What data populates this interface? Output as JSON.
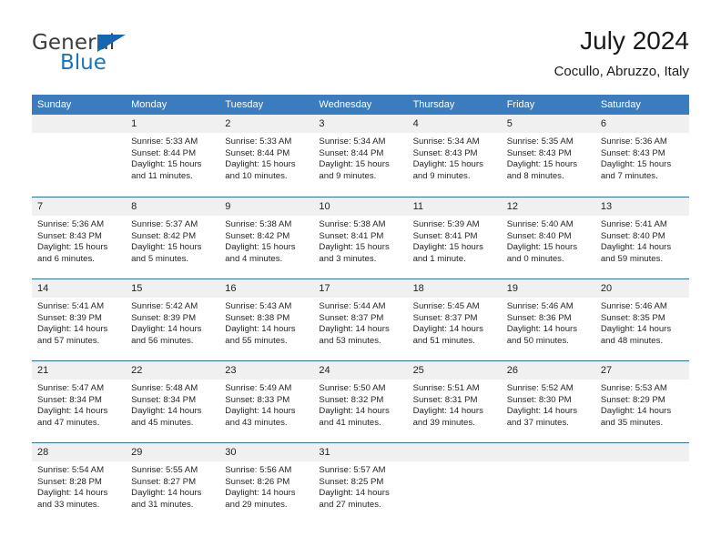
{
  "brand": {
    "name_top": "General",
    "name_bottom": "Blue",
    "accent_color": "#1b75bb",
    "triangle_color": "#1567b2"
  },
  "header": {
    "title": "July 2024",
    "subtitle": "Cocullo, Abruzzo, Italy"
  },
  "calendar": {
    "header_bg": "#3a7cbe",
    "header_text_color": "#ffffff",
    "daynum_band_bg": "#f0f0f0",
    "row_divider_color": "#2f6ea8",
    "weekdays": [
      "Sunday",
      "Monday",
      "Tuesday",
      "Wednesday",
      "Thursday",
      "Friday",
      "Saturday"
    ],
    "weeks": [
      [
        {
          "day": "",
          "lines": []
        },
        {
          "day": "1",
          "lines": [
            "Sunrise: 5:33 AM",
            "Sunset: 8:44 PM",
            "Daylight: 15 hours",
            "and 11 minutes."
          ]
        },
        {
          "day": "2",
          "lines": [
            "Sunrise: 5:33 AM",
            "Sunset: 8:44 PM",
            "Daylight: 15 hours",
            "and 10 minutes."
          ]
        },
        {
          "day": "3",
          "lines": [
            "Sunrise: 5:34 AM",
            "Sunset: 8:44 PM",
            "Daylight: 15 hours",
            "and 9 minutes."
          ]
        },
        {
          "day": "4",
          "lines": [
            "Sunrise: 5:34 AM",
            "Sunset: 8:43 PM",
            "Daylight: 15 hours",
            "and 9 minutes."
          ]
        },
        {
          "day": "5",
          "lines": [
            "Sunrise: 5:35 AM",
            "Sunset: 8:43 PM",
            "Daylight: 15 hours",
            "and 8 minutes."
          ]
        },
        {
          "day": "6",
          "lines": [
            "Sunrise: 5:36 AM",
            "Sunset: 8:43 PM",
            "Daylight: 15 hours",
            "and 7 minutes."
          ]
        }
      ],
      [
        {
          "day": "7",
          "lines": [
            "Sunrise: 5:36 AM",
            "Sunset: 8:43 PM",
            "Daylight: 15 hours",
            "and 6 minutes."
          ]
        },
        {
          "day": "8",
          "lines": [
            "Sunrise: 5:37 AM",
            "Sunset: 8:42 PM",
            "Daylight: 15 hours",
            "and 5 minutes."
          ]
        },
        {
          "day": "9",
          "lines": [
            "Sunrise: 5:38 AM",
            "Sunset: 8:42 PM",
            "Daylight: 15 hours",
            "and 4 minutes."
          ]
        },
        {
          "day": "10",
          "lines": [
            "Sunrise: 5:38 AM",
            "Sunset: 8:41 PM",
            "Daylight: 15 hours",
            "and 3 minutes."
          ]
        },
        {
          "day": "11",
          "lines": [
            "Sunrise: 5:39 AM",
            "Sunset: 8:41 PM",
            "Daylight: 15 hours",
            "and 1 minute."
          ]
        },
        {
          "day": "12",
          "lines": [
            "Sunrise: 5:40 AM",
            "Sunset: 8:40 PM",
            "Daylight: 15 hours",
            "and 0 minutes."
          ]
        },
        {
          "day": "13",
          "lines": [
            "Sunrise: 5:41 AM",
            "Sunset: 8:40 PM",
            "Daylight: 14 hours",
            "and 59 minutes."
          ]
        }
      ],
      [
        {
          "day": "14",
          "lines": [
            "Sunrise: 5:41 AM",
            "Sunset: 8:39 PM",
            "Daylight: 14 hours",
            "and 57 minutes."
          ]
        },
        {
          "day": "15",
          "lines": [
            "Sunrise: 5:42 AM",
            "Sunset: 8:39 PM",
            "Daylight: 14 hours",
            "and 56 minutes."
          ]
        },
        {
          "day": "16",
          "lines": [
            "Sunrise: 5:43 AM",
            "Sunset: 8:38 PM",
            "Daylight: 14 hours",
            "and 55 minutes."
          ]
        },
        {
          "day": "17",
          "lines": [
            "Sunrise: 5:44 AM",
            "Sunset: 8:37 PM",
            "Daylight: 14 hours",
            "and 53 minutes."
          ]
        },
        {
          "day": "18",
          "lines": [
            "Sunrise: 5:45 AM",
            "Sunset: 8:37 PM",
            "Daylight: 14 hours",
            "and 51 minutes."
          ]
        },
        {
          "day": "19",
          "lines": [
            "Sunrise: 5:46 AM",
            "Sunset: 8:36 PM",
            "Daylight: 14 hours",
            "and 50 minutes."
          ]
        },
        {
          "day": "20",
          "lines": [
            "Sunrise: 5:46 AM",
            "Sunset: 8:35 PM",
            "Daylight: 14 hours",
            "and 48 minutes."
          ]
        }
      ],
      [
        {
          "day": "21",
          "lines": [
            "Sunrise: 5:47 AM",
            "Sunset: 8:34 PM",
            "Daylight: 14 hours",
            "and 47 minutes."
          ]
        },
        {
          "day": "22",
          "lines": [
            "Sunrise: 5:48 AM",
            "Sunset: 8:34 PM",
            "Daylight: 14 hours",
            "and 45 minutes."
          ]
        },
        {
          "day": "23",
          "lines": [
            "Sunrise: 5:49 AM",
            "Sunset: 8:33 PM",
            "Daylight: 14 hours",
            "and 43 minutes."
          ]
        },
        {
          "day": "24",
          "lines": [
            "Sunrise: 5:50 AM",
            "Sunset: 8:32 PM",
            "Daylight: 14 hours",
            "and 41 minutes."
          ]
        },
        {
          "day": "25",
          "lines": [
            "Sunrise: 5:51 AM",
            "Sunset: 8:31 PM",
            "Daylight: 14 hours",
            "and 39 minutes."
          ]
        },
        {
          "day": "26",
          "lines": [
            "Sunrise: 5:52 AM",
            "Sunset: 8:30 PM",
            "Daylight: 14 hours",
            "and 37 minutes."
          ]
        },
        {
          "day": "27",
          "lines": [
            "Sunrise: 5:53 AM",
            "Sunset: 8:29 PM",
            "Daylight: 14 hours",
            "and 35 minutes."
          ]
        }
      ],
      [
        {
          "day": "28",
          "lines": [
            "Sunrise: 5:54 AM",
            "Sunset: 8:28 PM",
            "Daylight: 14 hours",
            "and 33 minutes."
          ]
        },
        {
          "day": "29",
          "lines": [
            "Sunrise: 5:55 AM",
            "Sunset: 8:27 PM",
            "Daylight: 14 hours",
            "and 31 minutes."
          ]
        },
        {
          "day": "30",
          "lines": [
            "Sunrise: 5:56 AM",
            "Sunset: 8:26 PM",
            "Daylight: 14 hours",
            "and 29 minutes."
          ]
        },
        {
          "day": "31",
          "lines": [
            "Sunrise: 5:57 AM",
            "Sunset: 8:25 PM",
            "Daylight: 14 hours",
            "and 27 minutes."
          ]
        },
        {
          "day": "",
          "lines": []
        },
        {
          "day": "",
          "lines": []
        },
        {
          "day": "",
          "lines": []
        }
      ]
    ]
  }
}
